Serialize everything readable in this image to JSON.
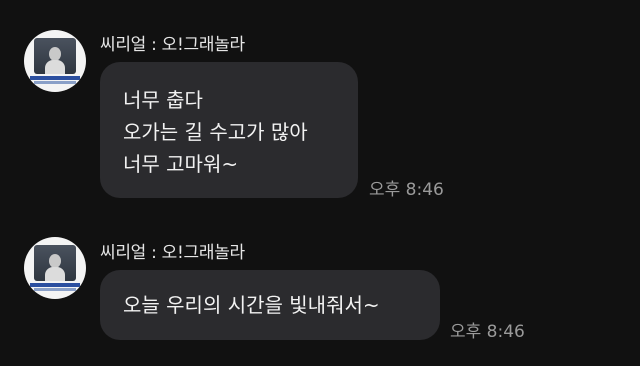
{
  "chat": {
    "messages": [
      {
        "sender": "씨리얼 : 오!그래놀라",
        "lines": [
          "너무 춥다",
          "오가는 길 수고가 많아",
          "너무 고마워~"
        ],
        "time": "오후 8:46"
      },
      {
        "sender": "씨리얼 : 오!그래놀라",
        "lines": [
          "오늘 우리의 시간을 빛내줘서~"
        ],
        "time": "오후 8:46"
      }
    ]
  }
}
